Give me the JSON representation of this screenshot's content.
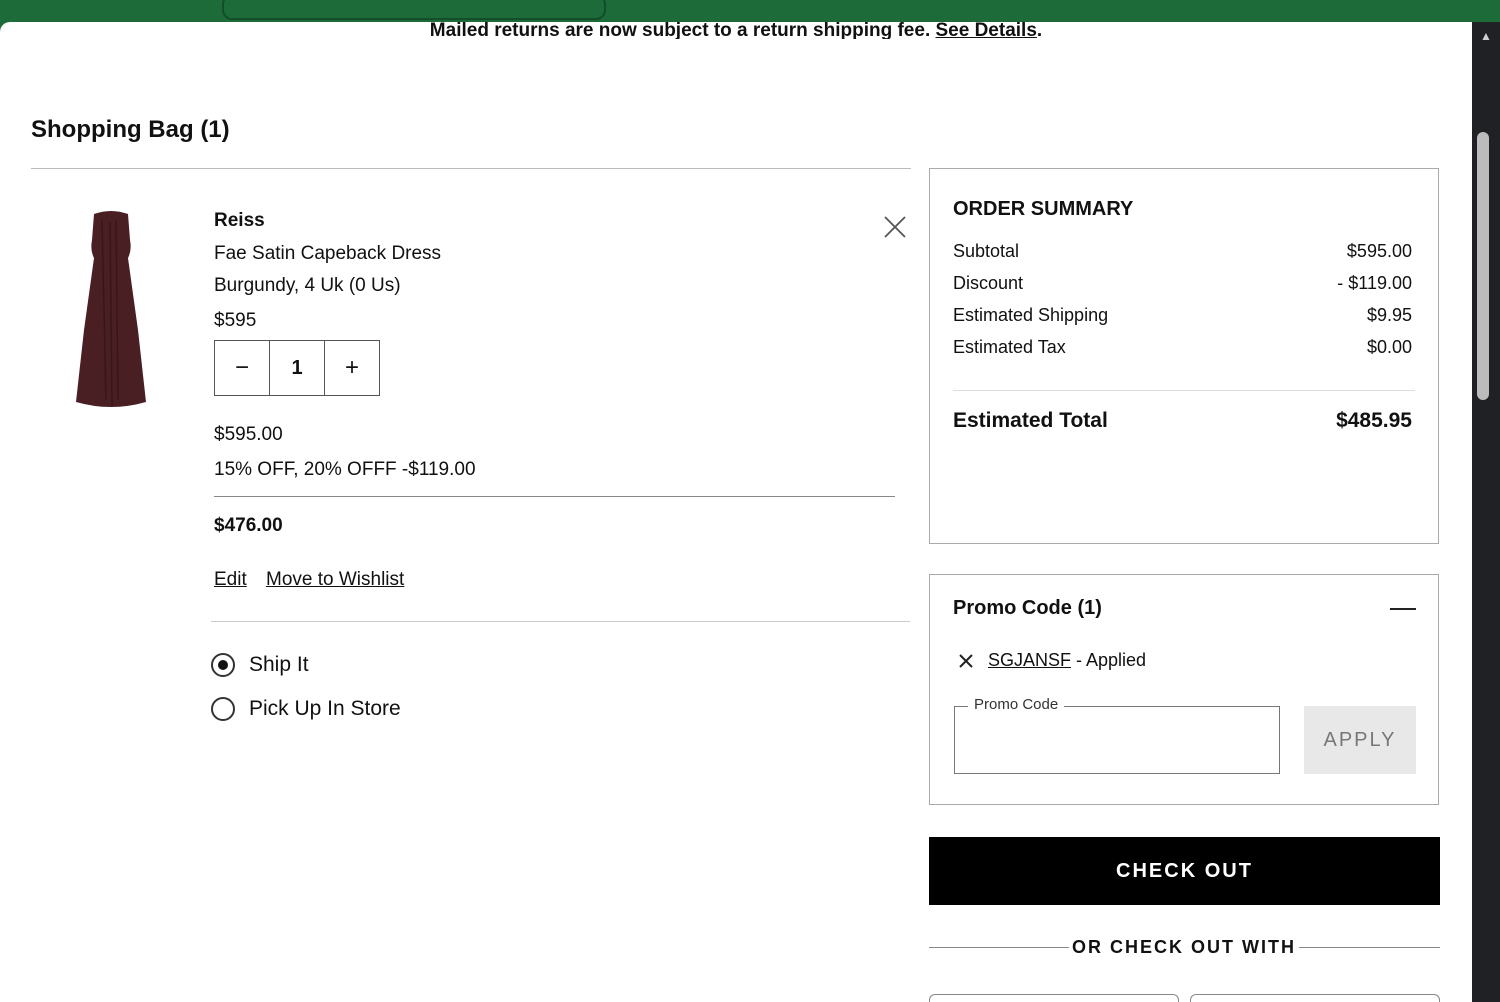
{
  "banner": {
    "text": "Mailed returns are now subject to a return shipping fee.",
    "link": "See Details"
  },
  "bag": {
    "title": "Shopping Bag (1)"
  },
  "item": {
    "brand": "Reiss",
    "name": "Fae Satin Capeback Dress",
    "variant": "Burgundy, 4 Uk (0 Us)",
    "price": "$595",
    "quantity": "1",
    "decrement": "−",
    "increment": "+",
    "original_total": "$595.00",
    "discount_line": "15% OFF, 20% OFFF -$119.00",
    "final_total": "$476.00",
    "edit_label": "Edit",
    "wishlist_label": "Move to Wishlist",
    "image_color": "#4a1f24"
  },
  "delivery": {
    "options": [
      {
        "label": "Ship It",
        "selected": true
      },
      {
        "label": "Pick Up In Store",
        "selected": false
      }
    ]
  },
  "summary": {
    "title": "ORDER SUMMARY",
    "rows": [
      {
        "label": "Subtotal",
        "value": "$595.00"
      },
      {
        "label": "Discount",
        "value": "- $119.00"
      },
      {
        "label": "Estimated Shipping",
        "value": "$9.95"
      },
      {
        "label": "Estimated Tax",
        "value": "$0.00"
      }
    ],
    "total_label": "Estimated Total",
    "total_value": "$485.95"
  },
  "promo": {
    "title": "Promo Code (1)",
    "applied_code": "SGJANSF",
    "applied_suffix": " - Applied",
    "field_label": "Promo Code",
    "field_value": "",
    "apply_label": "APPLY"
  },
  "checkout": {
    "button_label": "CHECK OUT",
    "alt_label": "OR CHECK OUT WITH"
  },
  "colors": {
    "browser_frame": "#1e6b3a",
    "checkout_button": "#000000",
    "apply_button": "#e8e8e8"
  }
}
